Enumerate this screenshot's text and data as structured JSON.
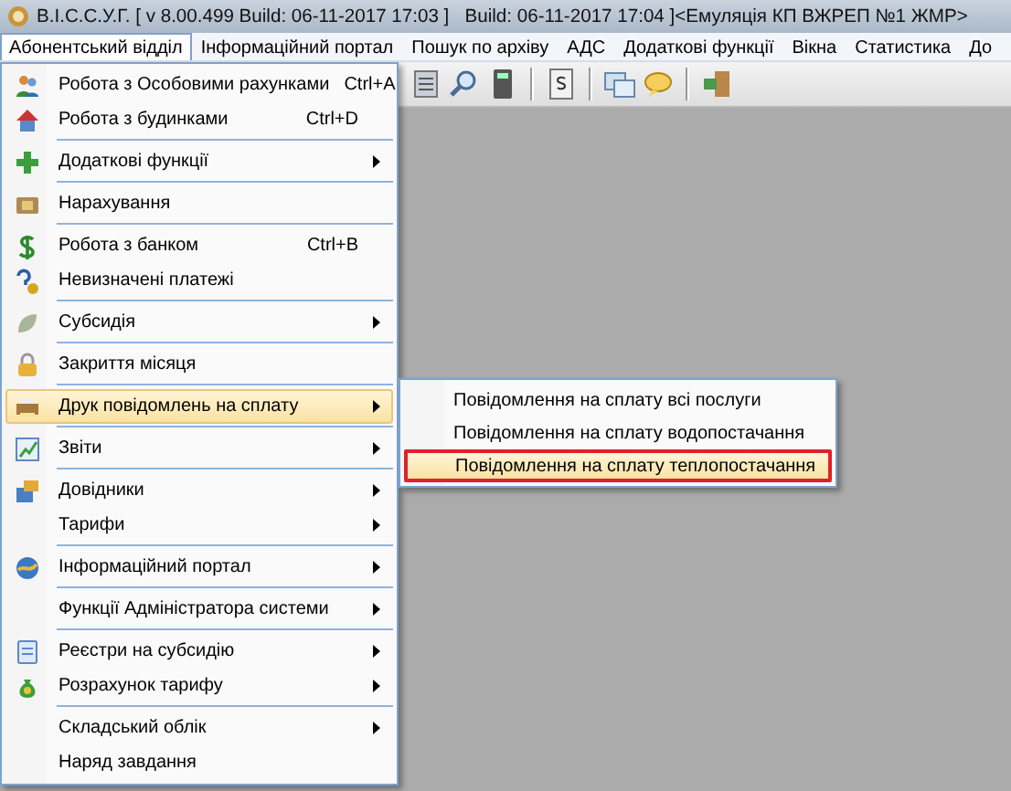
{
  "window": {
    "title": "В.І.С.С.У.Г. [ v 8.00.499 Build: 06-11-2017 17:03 ]   Build: 06-11-2017 17:04 ]<Емуляція КП ВЖРЕП №1 ЖМР>"
  },
  "menubar": [
    {
      "label": "Абонентський відділ",
      "selected": true
    },
    {
      "label": "Інформаційний портал",
      "selected": false
    },
    {
      "label": "Пошук по архіву",
      "selected": false
    },
    {
      "label": "АДС",
      "selected": false
    },
    {
      "label": "Додаткові функції",
      "selected": false
    },
    {
      "label": "Вікна",
      "selected": false
    },
    {
      "label": "Статистика",
      "selected": false
    },
    {
      "label": "До",
      "selected": false
    }
  ],
  "menu": {
    "items": [
      {
        "kind": "item",
        "label": "Робота з Особовими рахунками",
        "shortcut": "Ctrl+A",
        "submenu": false,
        "selected": false
      },
      {
        "kind": "item",
        "label": "Робота з будинками",
        "shortcut": "Ctrl+D",
        "submenu": false,
        "selected": false
      },
      {
        "kind": "separator"
      },
      {
        "kind": "item",
        "label": "Додаткові функції",
        "submenu": true,
        "selected": false
      },
      {
        "kind": "separator"
      },
      {
        "kind": "item",
        "label": "Нарахування",
        "submenu": false,
        "selected": false
      },
      {
        "kind": "separator"
      },
      {
        "kind": "item",
        "label": "Робота з банком",
        "shortcut": "Ctrl+B",
        "submenu": false,
        "selected": false
      },
      {
        "kind": "item",
        "label": "Невизначені платежі",
        "submenu": false,
        "selected": false
      },
      {
        "kind": "separator"
      },
      {
        "kind": "item",
        "label": "Субсидія",
        "submenu": true,
        "selected": false
      },
      {
        "kind": "separator"
      },
      {
        "kind": "item",
        "label": "Закриття місяця",
        "submenu": false,
        "selected": false
      },
      {
        "kind": "separator"
      },
      {
        "kind": "item",
        "label": "Друк повідомлень на сплату",
        "submenu": true,
        "selected": true
      },
      {
        "kind": "separator"
      },
      {
        "kind": "item",
        "label": "Звіти",
        "submenu": true,
        "selected": false
      },
      {
        "kind": "separator"
      },
      {
        "kind": "item",
        "label": "Довідники",
        "submenu": true,
        "selected": false
      },
      {
        "kind": "item",
        "label": "Тарифи",
        "submenu": true,
        "selected": false
      },
      {
        "kind": "separator"
      },
      {
        "kind": "item",
        "label": "Інформаційний портал",
        "submenu": true,
        "selected": false
      },
      {
        "kind": "separator"
      },
      {
        "kind": "item",
        "label": "Функції Адміністратора системи",
        "submenu": true,
        "selected": false
      },
      {
        "kind": "separator"
      },
      {
        "kind": "item",
        "label": "Реєстри на субсидію",
        "submenu": true,
        "selected": false
      },
      {
        "kind": "item",
        "label": "Розрахунок тарифу",
        "submenu": true,
        "selected": false
      },
      {
        "kind": "separator"
      },
      {
        "kind": "item",
        "label": "Складський облік",
        "submenu": true,
        "selected": false
      },
      {
        "kind": "item",
        "label": "Наряд завдання",
        "submenu": false,
        "selected": false
      }
    ]
  },
  "submenu": {
    "items": [
      {
        "label": "Повідомлення на сплату всі послуги",
        "selected": false,
        "outlined": false
      },
      {
        "label": "Повідомлення на сплату водопостачання",
        "selected": false,
        "outlined": false
      },
      {
        "label": "Повідомлення на сплату теплопостачання",
        "selected": true,
        "outlined": true
      }
    ]
  }
}
